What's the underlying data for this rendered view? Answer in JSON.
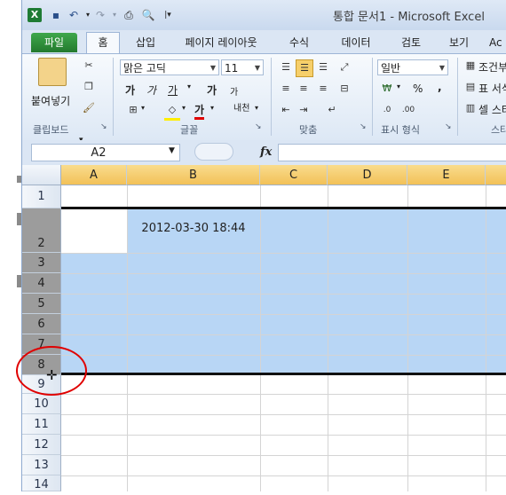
{
  "title_bar": {
    "title": "통합 문서1 - Microsoft Excel",
    "quick_access": [
      "excel-logo-icon",
      "save-icon",
      "undo-icon",
      "redo-icon",
      "print-preview-icon",
      "customize-icon"
    ]
  },
  "tabs": [
    "파일",
    "홈",
    "삽입",
    "페이지 레이아웃",
    "수식",
    "데이터",
    "검토",
    "보기",
    "Ac"
  ],
  "active_tab": "홈",
  "ribbon": {
    "clipboard": {
      "paste_label": "붙여넣기",
      "group_label": "클립보드"
    },
    "font": {
      "font_name": "맑은 고딕",
      "font_size": "11",
      "bold": "가",
      "italic": "가",
      "underline": "가",
      "grow": "가",
      "shrink": "가",
      "phonetic": "내천",
      "font_color_glyph": "가",
      "group_label": "글꼴"
    },
    "alignment": {
      "group_label": "맞춤"
    },
    "number": {
      "format": "일반",
      "percent": "%",
      "comma": ",",
      "group_label": "표시 형식"
    },
    "styles": {
      "conditional": "조건부",
      "table": "표 서식",
      "cell": "셀 스타일",
      "group_label": "스타일"
    }
  },
  "formula_bar": {
    "name_box": "A2",
    "fx": "fx",
    "content": ""
  },
  "columns": [
    "A",
    "B",
    "C",
    "D",
    "E"
  ],
  "rows": [
    "1",
    "2",
    "3",
    "4",
    "5",
    "6",
    "7",
    "8",
    "9",
    "10",
    "11",
    "12",
    "13",
    "14"
  ],
  "cells": {
    "B2": "2012-03-30 18:44"
  },
  "colors": {
    "selection": "#b8d6f5",
    "annotation": "#e00000",
    "file_tab": "#2e8b3a"
  }
}
